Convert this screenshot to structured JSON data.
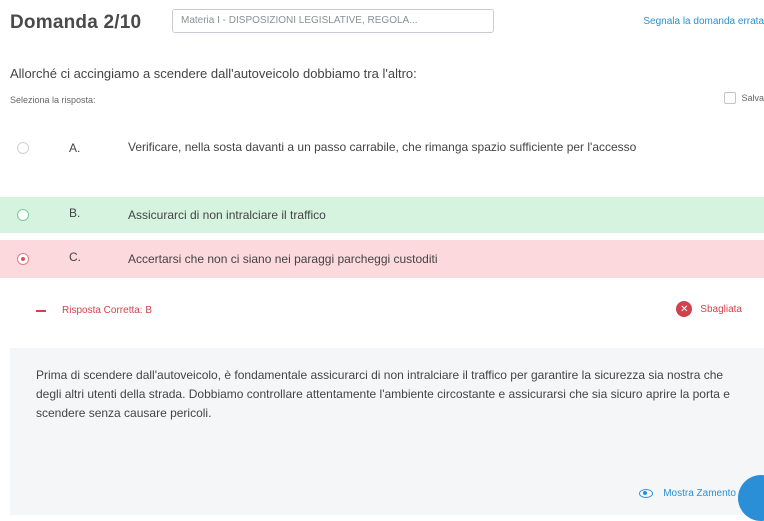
{
  "header": {
    "title": "Domanda 2/10",
    "subject": "Materia I - DISPOSIZIONI LEGISLATIVE, REGOLA...",
    "report_link": "Segnala la domanda errata"
  },
  "question": {
    "text": "Allorché ci accingiamo a scendere dall'autoveicolo dobbiamo tra l'altro:",
    "hint": "Seleziona la risposta:",
    "save_label": "Salva"
  },
  "options": [
    {
      "letter": "A.",
      "text": "Verificare, nella sosta davanti a un passo carrabile, che rimanga spazio sufficiente per l'accesso",
      "state": "neutral"
    },
    {
      "letter": "B.",
      "text": "Assicurarci di non intralciare il traffico",
      "state": "correct"
    },
    {
      "letter": "C.",
      "text": "Accertarsi che non ci siano nei paraggi parcheggi custoditi",
      "state": "wrong-selected"
    }
  ],
  "explanation": {
    "correct_label": "Risposta Corretta: B",
    "result_label": "Sbagliata",
    "text": "Prima di scendere dall'autoveicolo, è fondamentale assicurarci di non intralciare il traffico per garantire la sicurezza sia nostra che degli altri utenti della strada. Dobbiamo controllare attentamente l'ambiente circostante e assicurarsi che sia sicuro aprire la porta e scendere senza causare pericoli.",
    "show_less_label": "Mostra Zamento"
  },
  "colors": {
    "accent": "#2a8fd6",
    "correct_bg": "#d6f3e0",
    "wrong_bg": "#fbd9dc",
    "error": "#d0424c"
  },
  "icons": [
    "minus-icon",
    "close-icon",
    "eye-icon"
  ]
}
